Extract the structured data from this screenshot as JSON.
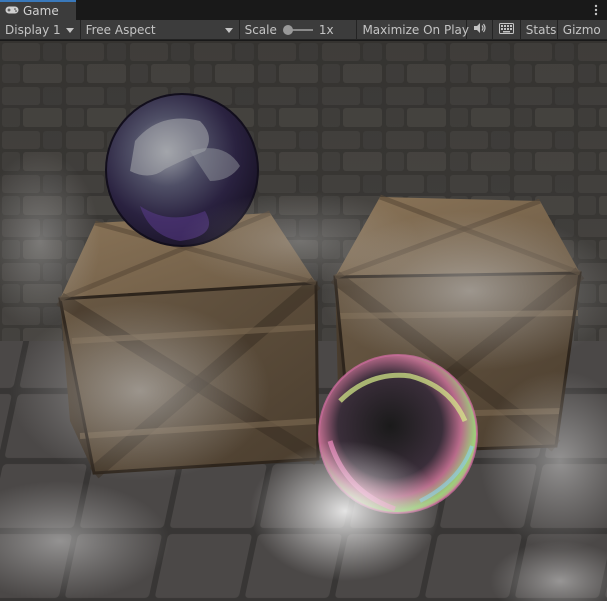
{
  "tab": {
    "icon": "gamepad-icon",
    "label": "Game"
  },
  "tab_menu": {
    "icon": "kebab-menu-icon"
  },
  "toolbar": {
    "display": "Display 1",
    "aspect": "Free Aspect",
    "scale_label": "Scale",
    "scale_value": "1x",
    "scale_level": 0.0,
    "maximize": "Maximize On Play",
    "mute_icon": "speaker-icon",
    "keyboard_icon": "keyboard-icon",
    "stats": "Stats",
    "gizmos": "Gizmo"
  },
  "colors": {
    "accent": "#3a79bb",
    "toolbar_bg": "#3c3c3c",
    "tab_bg": "#191919"
  },
  "scene": {
    "objects": [
      "stone-wall",
      "stone-floor",
      "crate-left",
      "crate-right",
      "dark-reflective-sphere",
      "iridescent-reflective-sphere",
      "fog"
    ]
  }
}
